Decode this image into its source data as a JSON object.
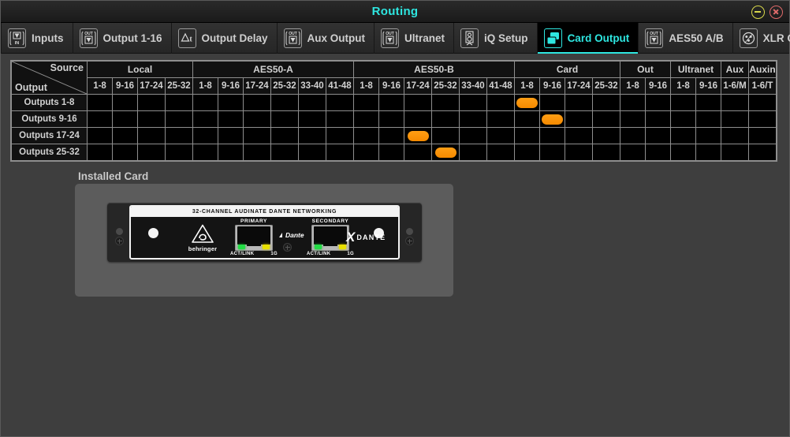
{
  "window": {
    "title": "Routing",
    "minimize_label": "minimize",
    "close_label": "close"
  },
  "tabs": [
    {
      "label": "Inputs",
      "icon": "input-arrow-icon",
      "active": false
    },
    {
      "label": "Output 1-16",
      "icon": "output-arrow-icon",
      "active": false
    },
    {
      "label": "Output Delay",
      "icon": "delta-t-icon",
      "active": false
    },
    {
      "label": "Aux Output",
      "icon": "output-arrow-icon",
      "active": false
    },
    {
      "label": "Ultranet",
      "icon": "output-arrow-icon",
      "active": false
    },
    {
      "label": "iQ Setup",
      "icon": "speaker-icon",
      "active": false
    },
    {
      "label": "Card Output",
      "icon": "cards-icon",
      "active": true
    },
    {
      "label": "AES50 A/B",
      "icon": "output-arrow-icon",
      "active": false
    },
    {
      "label": "XLR Output",
      "icon": "xlr-connector-icon",
      "active": false
    }
  ],
  "matrix": {
    "corner_source_label": "Source",
    "corner_output_label": "Output",
    "groups": [
      {
        "name": "Local",
        "span": 4
      },
      {
        "name": "AES50-A",
        "span": 6
      },
      {
        "name": "AES50-B",
        "span": 6
      },
      {
        "name": "Card",
        "span": 4
      },
      {
        "name": "Out",
        "span": 2
      },
      {
        "name": "Ultranet",
        "span": 2
      },
      {
        "name": "Aux",
        "span": 1
      },
      {
        "name": "Auxin",
        "span": 1
      }
    ],
    "columns": [
      "1-8",
      "9-16",
      "17-24",
      "25-32",
      "1-8",
      "9-16",
      "17-24",
      "25-32",
      "33-40",
      "41-48",
      "1-8",
      "9-16",
      "17-24",
      "25-32",
      "33-40",
      "41-48",
      "1-8",
      "9-16",
      "17-24",
      "25-32",
      "1-8",
      "9-16",
      "1-8",
      "9-16",
      "1-6/M",
      "1-6/T"
    ],
    "rows": [
      {
        "label": "Outputs 1-8",
        "selected_column": 16
      },
      {
        "label": "Outputs 9-16",
        "selected_column": 17
      },
      {
        "label": "Outputs 17-24",
        "selected_column": 12
      },
      {
        "label": "Outputs 25-32",
        "selected_column": 13
      }
    ],
    "accent_color": "#f58a00",
    "grid_line_color": "#8e8e8e"
  },
  "installed_card": {
    "section_label": "Installed Card",
    "title": "32-CHANNEL AUDINATE DANTE NETWORKING",
    "brand": "behringer",
    "ports": [
      {
        "name": "PRIMARY",
        "led_left": "ACT/LINK",
        "led_right": "1G"
      },
      {
        "name": "SECONDARY",
        "led_left": "ACT/LINK",
        "led_right": "1G"
      }
    ],
    "dante_small_logo": "Dante",
    "dante_big_logo": "DANTE",
    "led_act_color": "#22dd44",
    "led_speed_color": "#e8e000"
  },
  "theme": {
    "accent_cyan": "#2ee6e0",
    "background": "#3e3e3e",
    "orange": "#f58a00"
  }
}
